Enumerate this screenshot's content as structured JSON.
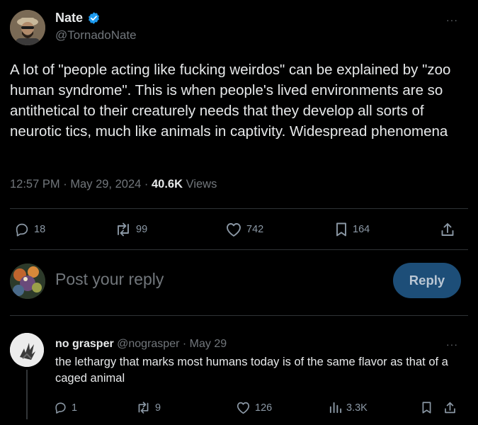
{
  "tweet": {
    "author_name": "Nate",
    "author_handle": "@TornadoNate",
    "text": "A lot of \"people acting like fucking weirdos\" can be explained by \"zoo human syndrome\". This is when people's lived environments are so antithetical to their creaturely needs that they develop all sorts of neurotic tics, much like animals in captivity. Widespread phenomena",
    "time": "12:57 PM",
    "date": "May 29, 2024",
    "views_count": "40.6K",
    "views_label": "Views",
    "replies": "18",
    "retweets": "99",
    "likes": "742",
    "bookmarks": "164",
    "more": "···"
  },
  "composer": {
    "placeholder": "Post your reply",
    "reply_button": "Reply"
  },
  "reply": {
    "author_name": "no grasper",
    "author_handle": "@nograsper",
    "date": "May 29",
    "text": "the lethargy that marks most humans today is of the same flavor as that of a caged animal",
    "replies": "1",
    "retweets": "9",
    "likes": "126",
    "views": "3.3K",
    "more": "···"
  },
  "separator": "·",
  "colors": {
    "background": "#000000",
    "verified": "#1d9bf0",
    "muted": "#71767b",
    "reply_button": "#1d4e78"
  },
  "icons": [
    "verified-badge-icon",
    "more-icon",
    "reply-icon",
    "retweet-icon",
    "like-icon",
    "bookmark-icon",
    "share-icon",
    "views-icon"
  ]
}
